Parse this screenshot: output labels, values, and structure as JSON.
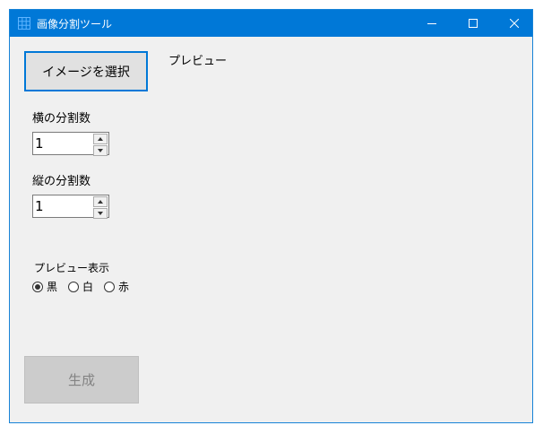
{
  "window": {
    "title": "画像分割ツール",
    "icon": "grid-icon",
    "controls": {
      "minimize": "minimize-icon",
      "maximize": "maximize-icon",
      "close": "close-icon"
    }
  },
  "select_button": {
    "label": "イメージを選択"
  },
  "preview": {
    "label": "プレビュー"
  },
  "horizontal": {
    "label": "横の分割数",
    "value": "1"
  },
  "vertical": {
    "label": "縦の分割数",
    "value": "1"
  },
  "preview_display": {
    "label": "プレビュー表示",
    "options": [
      {
        "label": "黒",
        "selected": true
      },
      {
        "label": "白",
        "selected": false
      },
      {
        "label": "赤",
        "selected": false
      }
    ]
  },
  "generate_button": {
    "label": "生成",
    "enabled": false
  },
  "colors": {
    "accent": "#0078d7",
    "background": "#f0f0f0",
    "disabled_text": "#838383"
  }
}
